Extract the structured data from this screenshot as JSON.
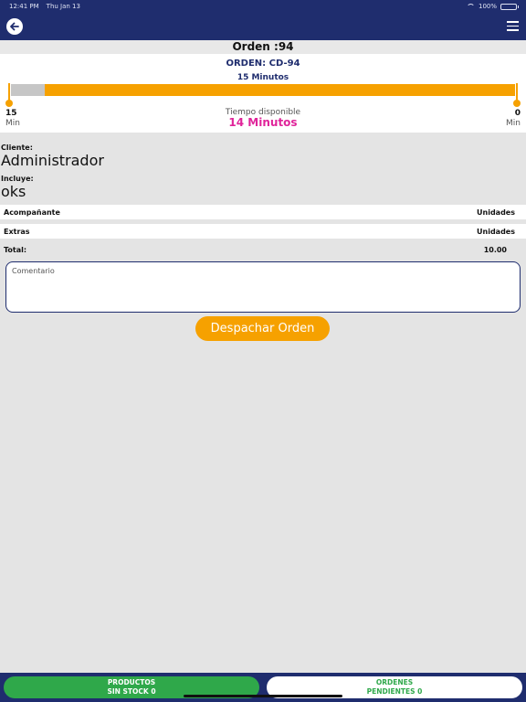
{
  "status_bar": {
    "time": "12:41 PM",
    "date": "Thu Jan 13",
    "battery": "100%"
  },
  "nav": {
    "back_icon": "arrow-left-icon",
    "menu_icon": "hamburger-menu-icon"
  },
  "order_title": "Orden :94",
  "timer": {
    "order_code": "ORDEN: CD-94",
    "total_minutes_label": "15 Minutos",
    "elapsed_fraction": 0.067,
    "left_value": "15",
    "left_unit": "Min",
    "right_value": "0",
    "right_unit": "Min",
    "available_label": "Tiempo disponible",
    "available_value": "14 Minutos",
    "bar_color": "#f6a100",
    "elapsed_color": "#c6c6c6",
    "highlight_color": "#e0249a"
  },
  "client": {
    "label": "Cliente:",
    "value": "Administrador"
  },
  "includes": {
    "label": "Incluye:",
    "value": "oks"
  },
  "rows": [
    {
      "name": "Acompañante",
      "unit": "Unidades"
    },
    {
      "name": "Extras",
      "unit": "Unidades"
    }
  ],
  "total": {
    "label": "Total:",
    "value": "10.00"
  },
  "comment": {
    "placeholder": "Comentario",
    "value": ""
  },
  "dispatch_label": "Despachar Orden",
  "bottom_tabs": {
    "stock_line1": "PRODUCTOS",
    "stock_line2": "SIN STOCK 0",
    "orders_line1": "ORDENES",
    "orders_line2": "PENDIENTES 0"
  },
  "colors": {
    "brand": "#1f2d6e",
    "accent": "#f6a100",
    "success": "#2fa84a"
  }
}
